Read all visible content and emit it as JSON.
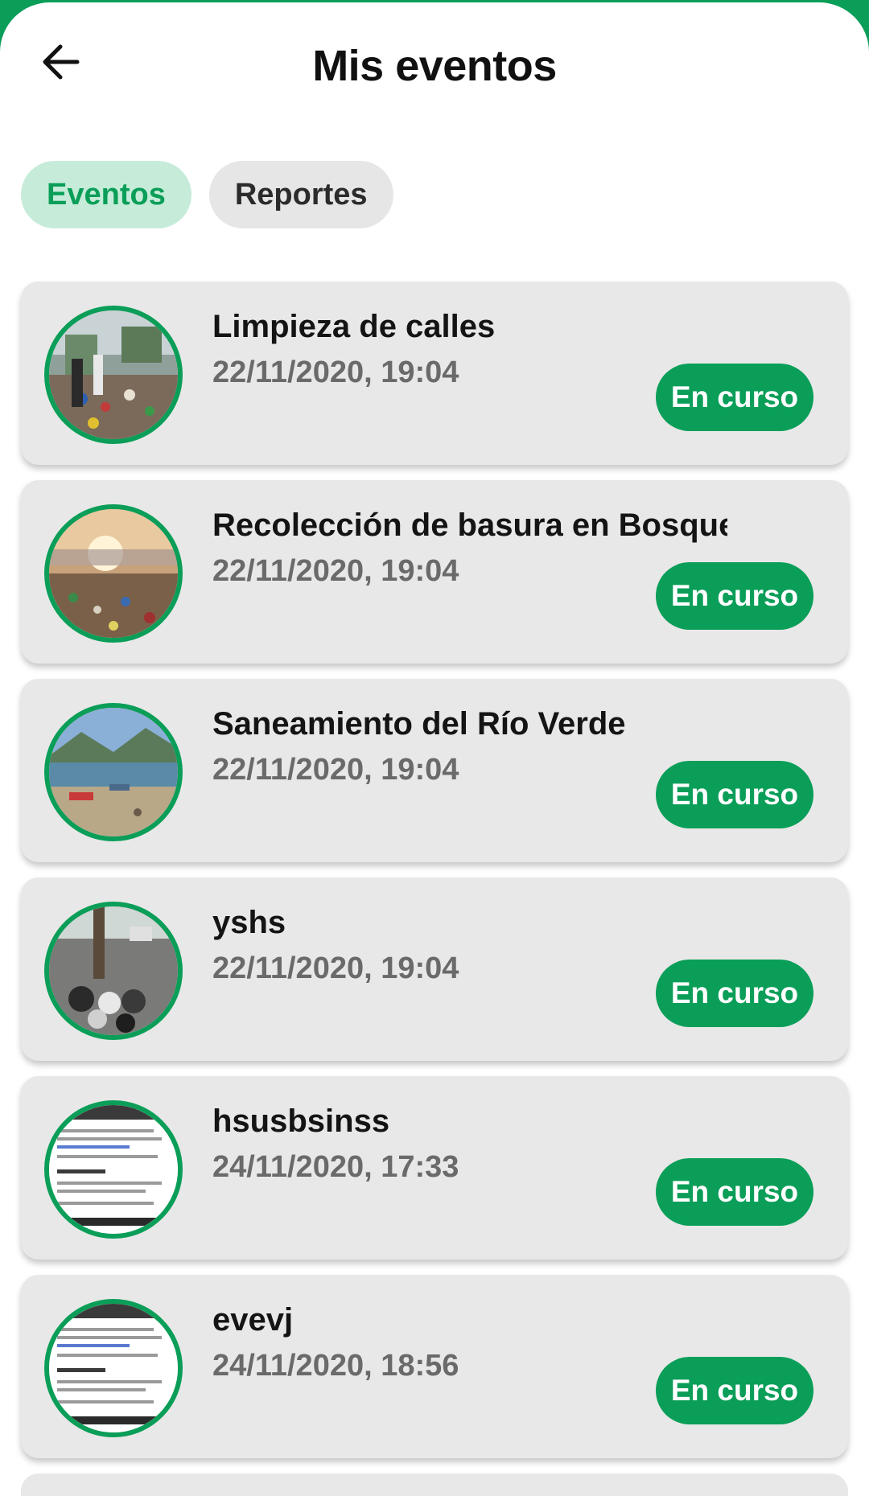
{
  "header": {
    "title": "Mis eventos",
    "back_icon": "arrow-left-icon"
  },
  "tabs": [
    {
      "label": "Eventos",
      "active": true
    },
    {
      "label": "Reportes",
      "active": false
    }
  ],
  "colors": {
    "brand_green": "#0a9e58",
    "active_tab_bg": "#c6ecd9",
    "card_bg": "#e8e8e8",
    "date_text": "#6a6a6a"
  },
  "events": [
    {
      "title": "Limpieza de calles",
      "date": "22/11/2020, 19:04",
      "status": "En curso",
      "image": "street-trash-photo"
    },
    {
      "title": "Recolección de basura en Bosque La",
      "date": "22/11/2020, 19:04",
      "status": "En curso",
      "image": "landfill-sunset-photo"
    },
    {
      "title": "Saneamiento del Río Verde",
      "date": "22/11/2020, 19:04",
      "status": "En curso",
      "image": "beach-boats-photo"
    },
    {
      "title": "yshs",
      "date": "22/11/2020, 19:04",
      "status": "En curso",
      "image": "street-garbage-bags-photo"
    },
    {
      "title": "hsusbsinss",
      "date": "24/11/2020, 17:33",
      "status": "En curso",
      "image": "web-screenshot-photo"
    },
    {
      "title": "evevj",
      "date": "24/11/2020, 18:56",
      "status": "En curso",
      "image": "web-screenshot-photo"
    }
  ]
}
